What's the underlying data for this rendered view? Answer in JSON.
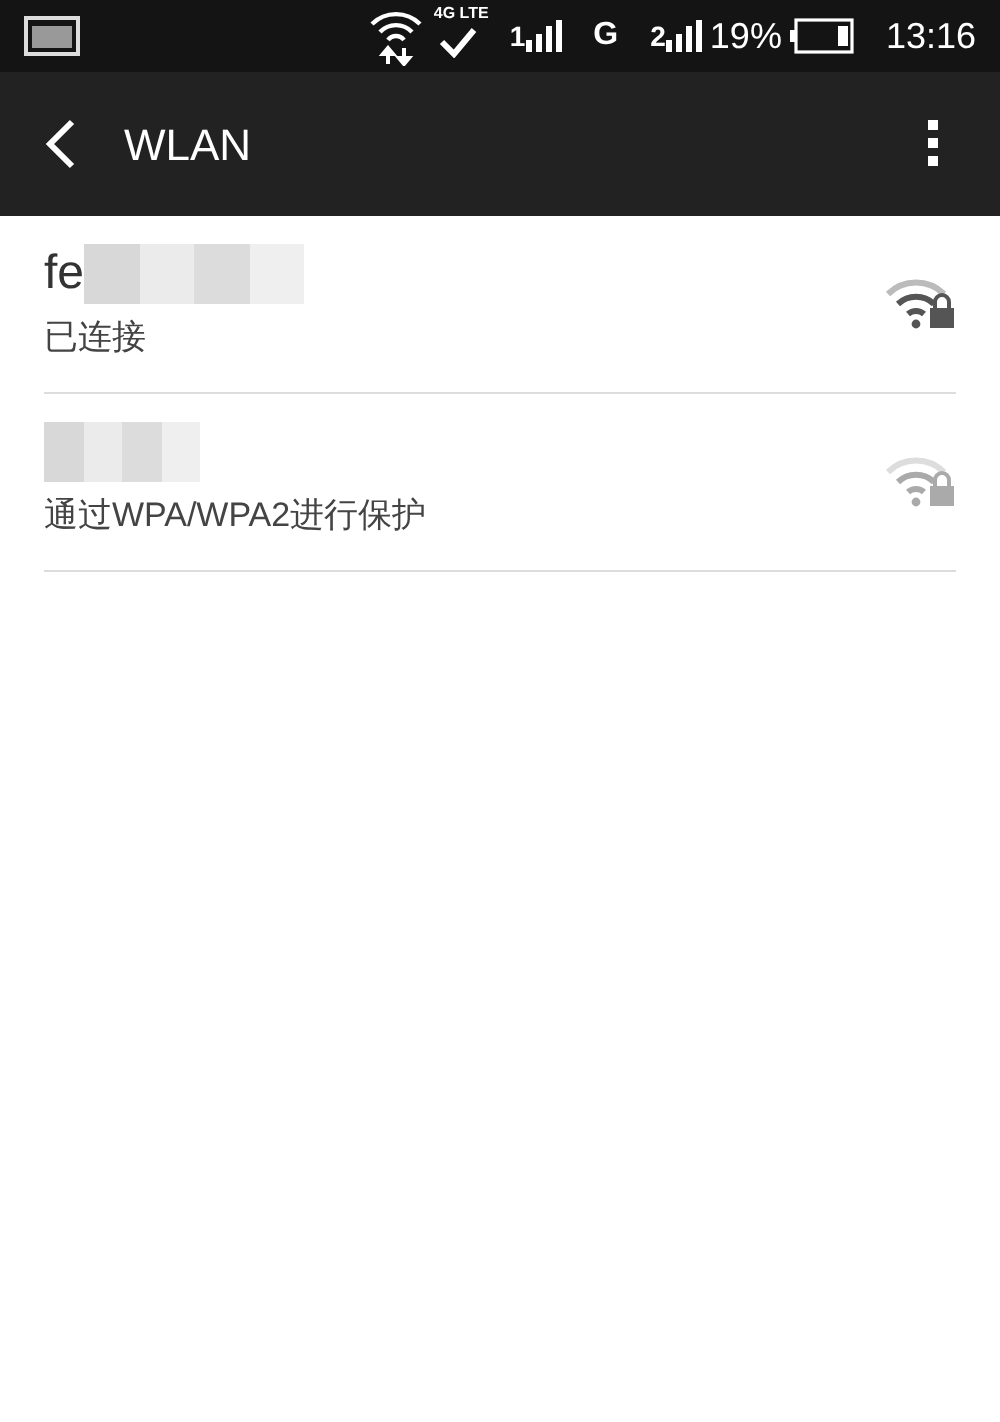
{
  "status_bar": {
    "network_type": "4G LTE",
    "sim1": "1",
    "data_type": "G",
    "sim2": "2",
    "battery": "19%",
    "time": "13:16"
  },
  "action_bar": {
    "title": "WLAN"
  },
  "networks": [
    {
      "name": "fe",
      "name_blurred": true,
      "status": "已连接",
      "signal_strong": true
    },
    {
      "name_blurred": true,
      "status": "通过WPA/WPA2进行保护",
      "signal_strong": false
    }
  ]
}
